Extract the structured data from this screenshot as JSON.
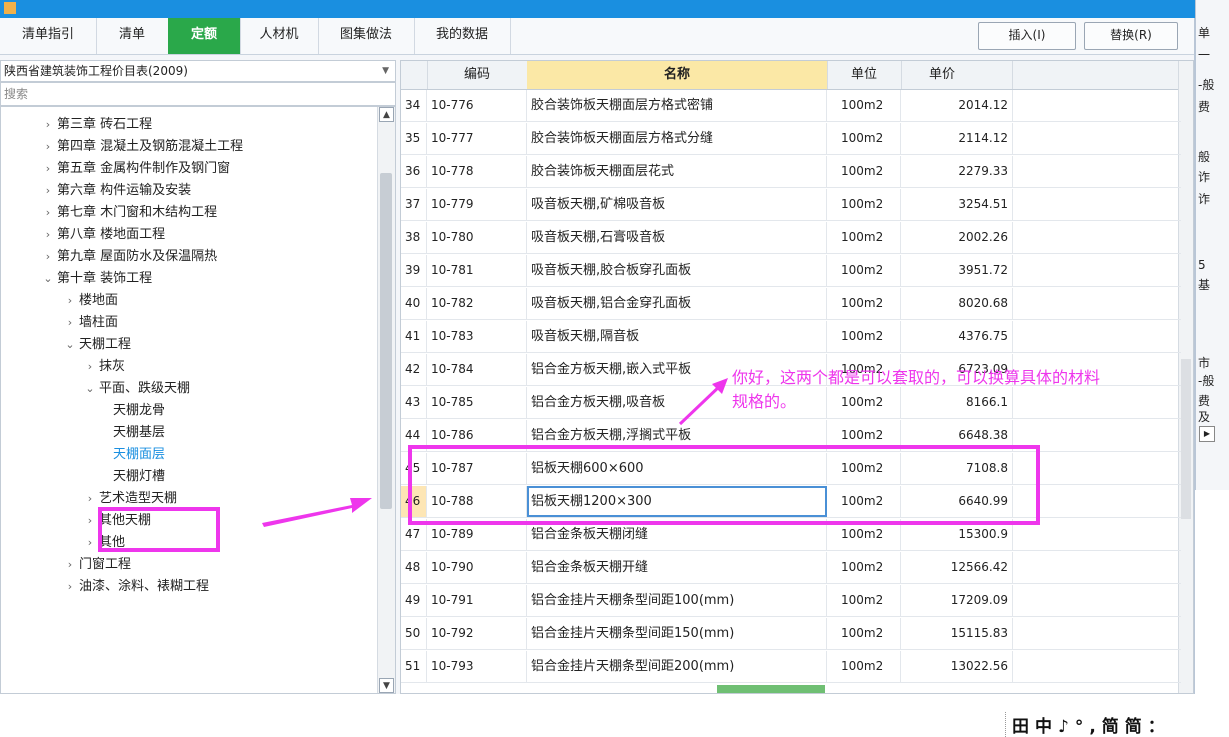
{
  "tabs": [
    "清单指引",
    "清单",
    "定额",
    "人材机",
    "图集做法",
    "我的数据"
  ],
  "active_tab": "定额",
  "buttons": {
    "insert": "插入(I)",
    "replace": "替换(R)"
  },
  "library_dropdown": "陕西省建筑装饰工程价目表(2009)",
  "search_placeholder": "搜索",
  "tree": [
    {
      "text": "第三章 砖石工程",
      "chev": "›"
    },
    {
      "text": "第四章 混凝土及钢筋混凝土工程",
      "chev": "›"
    },
    {
      "text": "第五章 金属构件制作及钢门窗",
      "chev": "›"
    },
    {
      "text": "第六章 构件运输及安装",
      "chev": "›"
    },
    {
      "text": "第七章 木门窗和木结构工程",
      "chev": "›"
    },
    {
      "text": "第八章 楼地面工程",
      "chev": "›"
    },
    {
      "text": "第九章 屋面防水及保温隔热",
      "chev": "›"
    },
    {
      "text": "第十章 装饰工程",
      "chev": "⌄"
    },
    {
      "text": "楼地面",
      "chev": "›"
    },
    {
      "text": "墙柱面",
      "chev": "›"
    },
    {
      "text": "天棚工程",
      "chev": "⌄"
    },
    {
      "text": "抹灰",
      "chev": "›"
    },
    {
      "text": "平面、跌级天棚",
      "chev": "⌄"
    },
    {
      "text": "天棚龙骨",
      "chev": ""
    },
    {
      "text": "天棚基层",
      "chev": ""
    },
    {
      "text": "天棚面层",
      "chev": ""
    },
    {
      "text": "天棚灯槽",
      "chev": ""
    },
    {
      "text": "艺术造型天棚",
      "chev": "›"
    },
    {
      "text": "其他天棚",
      "chev": "›"
    },
    {
      "text": "其他",
      "chev": "›"
    },
    {
      "text": "门窗工程",
      "chev": "›"
    },
    {
      "text": "油漆、涂料、裱糊工程",
      "chev": "›"
    }
  ],
  "selected_tree_item": "天棚面层",
  "grid": {
    "headers": [
      "",
      "编码",
      "名称",
      "单位",
      "单价"
    ],
    "rows": [
      [
        "34",
        "10-776",
        "胶合装饰板天棚面层方格式密铺",
        "100m2",
        "2014.12"
      ],
      [
        "35",
        "10-777",
        "胶合装饰板天棚面层方格式分缝",
        "100m2",
        "2114.12"
      ],
      [
        "36",
        "10-778",
        "胶合装饰板天棚面层花式",
        "100m2",
        "2279.33"
      ],
      [
        "37",
        "10-779",
        "吸音板天棚,矿棉吸音板",
        "100m2",
        "3254.51"
      ],
      [
        "38",
        "10-780",
        "吸音板天棚,石膏吸音板",
        "100m2",
        "2002.26"
      ],
      [
        "39",
        "10-781",
        "吸音板天棚,胶合板穿孔面板",
        "100m2",
        "3951.72"
      ],
      [
        "40",
        "10-782",
        "吸音板天棚,铝合金穿孔面板",
        "100m2",
        "8020.68"
      ],
      [
        "41",
        "10-783",
        "吸音板天棚,隔音板",
        "100m2",
        "4376.75"
      ],
      [
        "42",
        "10-784",
        "铝合金方板天棚,嵌入式平板",
        "100m2",
        "6723.09"
      ],
      [
        "43",
        "10-785",
        "铝合金方板天棚,吸音板",
        "100m2",
        "8166.1"
      ],
      [
        "44",
        "10-786",
        "铝合金方板天棚,浮搁式平板",
        "100m2",
        "6648.38"
      ],
      [
        "45",
        "10-787",
        "铝板天棚600×600",
        "100m2",
        "7108.8"
      ],
      [
        "46",
        "10-788",
        "铝板天棚1200×300",
        "100m2",
        "6640.99"
      ],
      [
        "47",
        "10-789",
        "铝合金条板天棚闭缝",
        "100m2",
        "15300.9"
      ],
      [
        "48",
        "10-790",
        "铝合金条板天棚开缝",
        "100m2",
        "12566.42"
      ],
      [
        "49",
        "10-791",
        "铝合金挂片天棚条型间距100(mm)",
        "100m2",
        "17209.09"
      ],
      [
        "50",
        "10-792",
        "铝合金挂片天棚条型间距150(mm)",
        "100m2",
        "15115.83"
      ],
      [
        "51",
        "10-793",
        "铝合金挂片天棚条型间距200(mm)",
        "100m2",
        "13022.56"
      ]
    ]
  },
  "annotation": {
    "line1": "你好，这两个都是可以套取的，可以换算具体的材料",
    "line2": "规格的。"
  },
  "right_strip": [
    "单",
    "一",
    "-般",
    "费",
    "般",
    "诈",
    "诈",
    "5",
    "基",
    "市",
    "-般",
    "费",
    "及"
  ],
  "ime_bar": "田中♪°,简简："
}
